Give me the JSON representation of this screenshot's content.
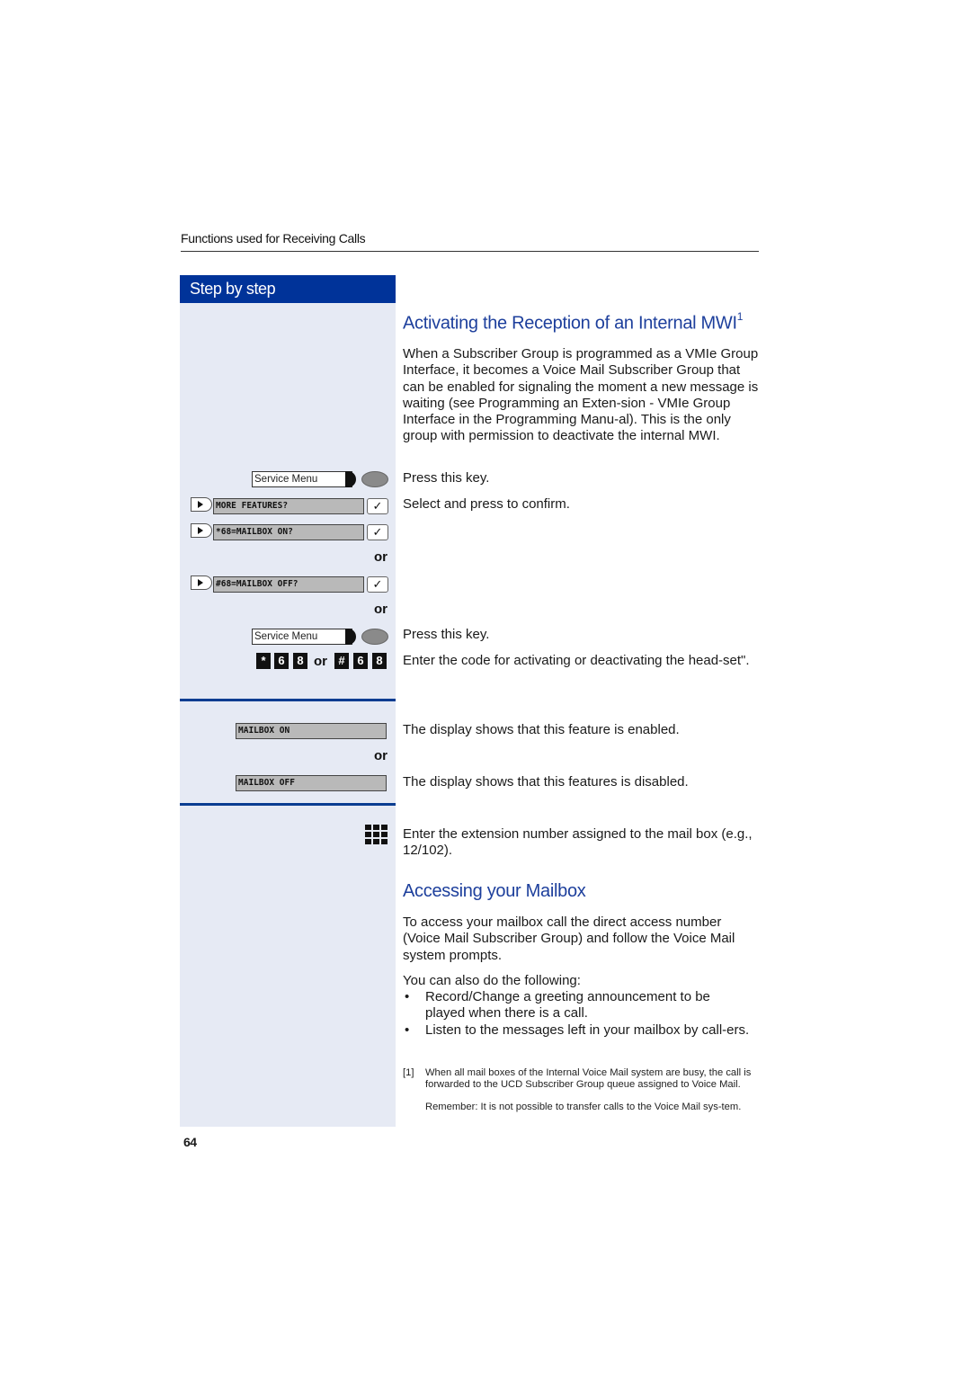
{
  "header": {
    "section_title": "Functions used for Receiving Calls"
  },
  "sidebar": {
    "title": "Step by step",
    "service_menu_label": "Service Menu",
    "lcd_more_features": "MORE FEATURES?",
    "lcd_mailbox_on_q": "*68=MAILBOX  ON?",
    "lcd_mailbox_off_q": "#68=MAILBOX OFF?",
    "or_label": "or",
    "code_keys_on": [
      "*",
      "6",
      "8"
    ],
    "code_keys_off": [
      "#",
      "6",
      "8"
    ],
    "lcd_mailbox_on": "MAILBOX ON",
    "lcd_mailbox_off": "MAILBOX OFF",
    "check_glyph": "✓",
    "icons": [
      "arrow-right-key-icon",
      "check-key-icon",
      "service-menu-key-icon",
      "keypad-icon"
    ]
  },
  "main": {
    "section1": {
      "title": "Activating the Reception of an Internal MWI",
      "footnote_ref": "1",
      "intro": "When a Subscriber Group is programmed as a VMIe Group Interface, it becomes a Voice Mail Subscriber Group that can be enabled for signaling the moment a new message is waiting (see Programming an Exten-sion - VMIe Group Interface in the Programming Manu-al). This is the only group with permission to deactivate the internal MWI.",
      "press_key_1": "Press this key.",
      "select_confirm": "Select and press to confirm.",
      "press_key_2": "Press this key.",
      "enter_code": "Enter the code for activating or deactivating the head-set\".",
      "display_enabled": "The display shows that this feature is enabled.",
      "display_disabled": "The display shows that this features is disabled.",
      "enter_extension": "Enter the extension number assigned to the mail box (e.g., 12/102)."
    },
    "section2": {
      "title": "Accessing your Mailbox",
      "intro": "To access your mailbox call the direct access number (Voice Mail Subscriber Group) and follow the Voice Mail system prompts.",
      "also": "You can also do the following:",
      "bullets": [
        "Record/Change a greeting announcement to be played when there is a call.",
        "Listen to the messages left in your mailbox by call-ers."
      ]
    },
    "footnote": {
      "marker": "[1]",
      "text": "When all mail boxes of the Internal Voice Mail system are busy, the call is forwarded to the UCD Subscriber Group queue assigned to Voice Mail.",
      "remember": "Remember: It is not possible to transfer calls to the Voice Mail sys-tem."
    }
  },
  "page_number": "64",
  "colors": {
    "brand_blue": "#003399",
    "heading_blue": "#1d3f9c",
    "sidebar_bg": "#e6eaf4",
    "lcd_gray": "#b9b9b9"
  }
}
